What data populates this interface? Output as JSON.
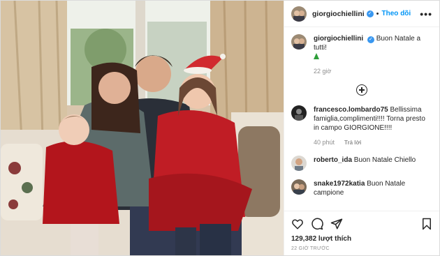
{
  "header": {
    "username": "giorgiochiellini",
    "separator": "•",
    "follow_label": "Theo dõi",
    "more_label": "•••"
  },
  "caption": {
    "username": "giorgiochiellini",
    "text": "Buon Natale a tutti!",
    "emoji": "christmas-tree",
    "time": "22 giờ"
  },
  "comments": [
    {
      "username": "francesco.lombardo75",
      "text": "Bellissima famiglia,complimenti!!!! Torna presto in campo GIORGIONE!!!!",
      "time": "40 phút",
      "reply": "Trả lời"
    },
    {
      "username": "roberto_ida",
      "text": "Buon Natale Chiello",
      "time": "",
      "reply": ""
    },
    {
      "username": "snake1972katia",
      "text": "Buon Natale campione",
      "time": "",
      "reply": ""
    }
  ],
  "actions": {
    "likes": "129,382 lượt thích",
    "time": "22 GIỜ TRƯỚC"
  },
  "icons": [
    "heart-icon",
    "comment-icon",
    "share-icon",
    "bookmark-icon",
    "add-comment-icon"
  ],
  "colors": {
    "link": "#0095f6",
    "verified": "#3897f0",
    "muted": "#8e8e8e"
  }
}
